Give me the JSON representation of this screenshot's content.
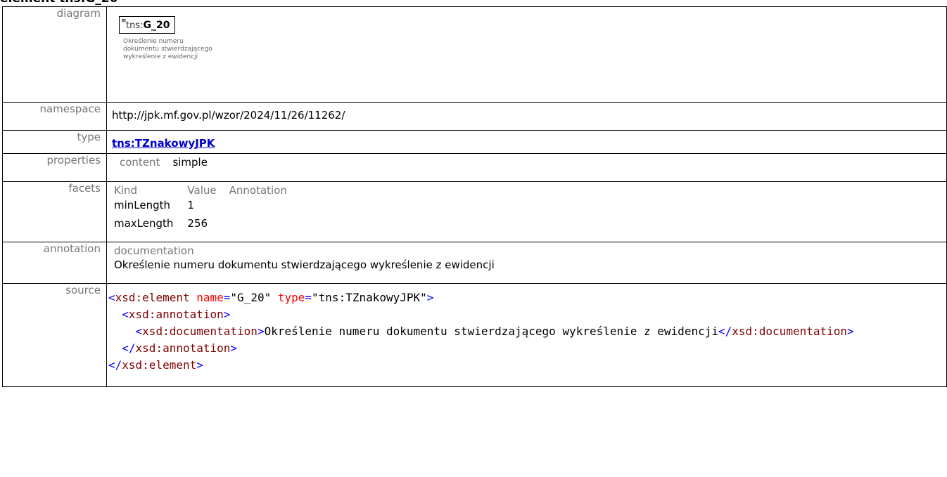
{
  "labels": {
    "diagram": "diagram",
    "namespace": "namespace",
    "type": "type",
    "properties": "properties",
    "facets": "facets",
    "annotation": "annotation",
    "source": "source"
  },
  "diagram": {
    "prefix": "tns:",
    "name": "G_20",
    "doc": "Określenie numeru\ndokumentu stwierdzającego\nwykreślenie z ewidencji"
  },
  "namespace": "http://jpk.mf.gov.pl/wzor/2024/11/26/11262/",
  "type_link": "tns:TZnakowyJPK",
  "properties": {
    "key": "content",
    "value": "simple"
  },
  "facets": {
    "headers": [
      "Kind",
      "Value",
      "Annotation"
    ],
    "rows": [
      {
        "kind": "minLength",
        "value": "1",
        "annotation": ""
      },
      {
        "kind": "maxLength",
        "value": "256",
        "annotation": ""
      }
    ]
  },
  "annotation": {
    "heading": "documentation",
    "text": "Określenie numeru dokumentu stwierdzającego wykreślenie z ewidencji"
  },
  "source": {
    "element_tag": "xsd:element",
    "attr_name_key": "name",
    "attr_name_val": "\"G_20\"",
    "attr_type_key": "type",
    "attr_type_val": "\"tns:TZnakowyJPK\"",
    "annotation_tag": "xsd:annotation",
    "documentation_tag": "xsd:documentation",
    "documentation_text": "Określenie numeru dokumentu stwierdzającego wykreślenie z ewidencji"
  }
}
